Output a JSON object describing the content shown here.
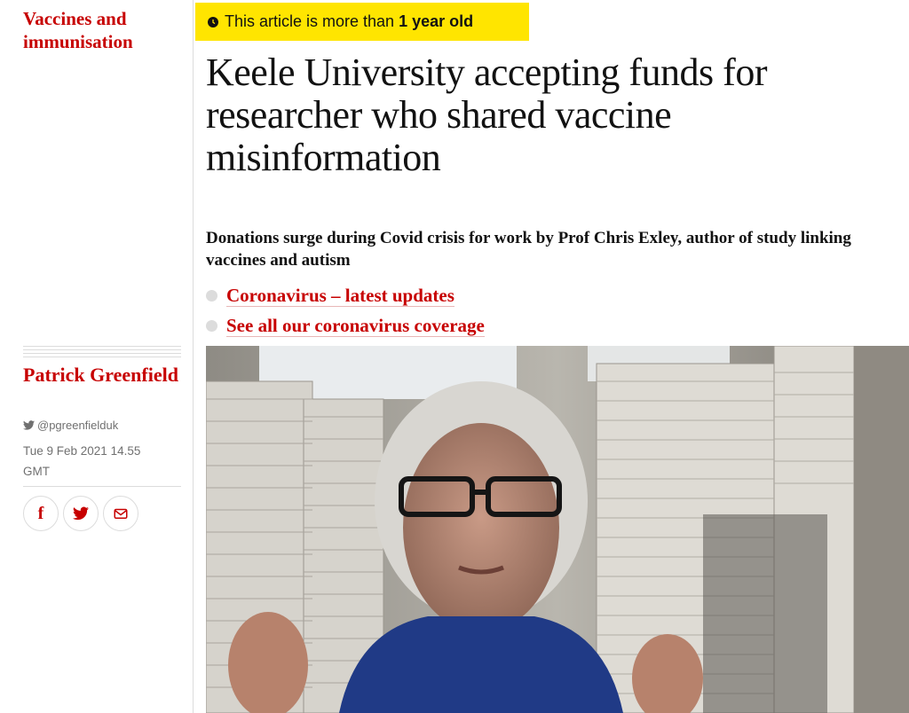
{
  "section": {
    "label": "Vaccines and immunisation"
  },
  "badge": {
    "prefix": "This article is more than",
    "age": "1 year old"
  },
  "article": {
    "headline": "Keele University accepting funds for researcher who shared vaccine misinformation",
    "standfirst": "Donations surge during Covid crisis for work by Prof Chris Exley, author of study linking vaccines and autism",
    "links": [
      {
        "label": "Coronavirus – latest updates"
      },
      {
        "label": "See all our coronavirus coverage"
      }
    ]
  },
  "byline": {
    "author": "Patrick Greenfield",
    "twitter": "@pgreenfielduk",
    "date": "Tue 9 Feb 2021 14.55 GMT"
  },
  "share": {
    "buttons": [
      {
        "icon": "facebook-icon",
        "glyph": "f"
      },
      {
        "icon": "twitter-icon"
      },
      {
        "icon": "email-icon"
      }
    ]
  },
  "colors": {
    "accent": "#c70000",
    "badge": "#ffe500",
    "text": "#121212",
    "muted": "#707070",
    "rule": "#dcdcdc"
  }
}
